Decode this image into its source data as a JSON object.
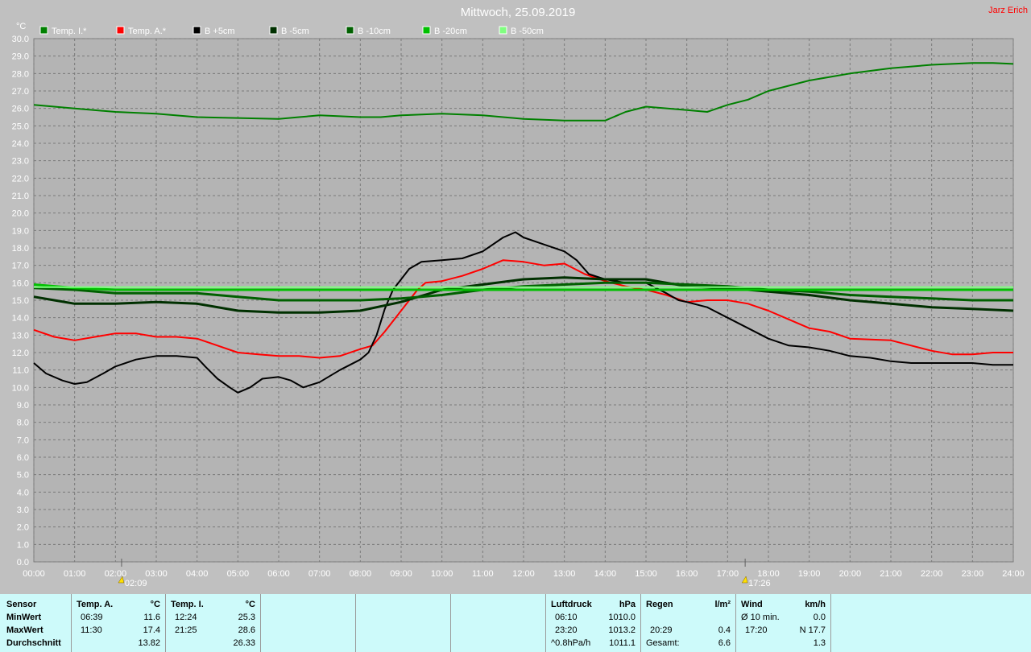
{
  "title": "Mittwoch, 25.09.2019",
  "author": "Jarz Erich",
  "chart_data": {
    "type": "line",
    "ylabel": "°C",
    "ylim": [
      0,
      30
    ],
    "ytick_step": 1,
    "xlim": [
      0,
      24
    ],
    "x_ticks": [
      "00:00",
      "01:00",
      "02:00",
      "03:00",
      "04:00",
      "05:00",
      "06:00",
      "07:00",
      "08:00",
      "09:00",
      "10:00",
      "11:00",
      "12:00",
      "13:00",
      "14:00",
      "15:00",
      "16:00",
      "17:00",
      "18:00",
      "19:00",
      "20:00",
      "21:00",
      "22:00",
      "23:00",
      "24:00"
    ],
    "grid": true,
    "legend_position": "top",
    "sunrise": {
      "hour": 2.15,
      "label": "02:09"
    },
    "sunset": {
      "hour": 17.43,
      "label": "17:26"
    },
    "series": [
      {
        "name": "Temp. I.*",
        "color": "#008000",
        "width": 2,
        "points": [
          [
            0,
            26.2
          ],
          [
            1,
            26.0
          ],
          [
            2,
            25.8
          ],
          [
            3,
            25.7
          ],
          [
            4,
            25.5
          ],
          [
            5,
            25.45
          ],
          [
            6,
            25.4
          ],
          [
            6.5,
            25.5
          ],
          [
            7,
            25.6
          ],
          [
            8,
            25.5
          ],
          [
            8.5,
            25.5
          ],
          [
            9,
            25.6
          ],
          [
            10,
            25.7
          ],
          [
            11,
            25.6
          ],
          [
            12,
            25.4
          ],
          [
            13,
            25.3
          ],
          [
            14,
            25.3
          ],
          [
            14.5,
            25.8
          ],
          [
            15,
            26.1
          ],
          [
            16,
            25.9
          ],
          [
            16.5,
            25.8
          ],
          [
            17,
            26.2
          ],
          [
            17.5,
            26.5
          ],
          [
            18,
            27.0
          ],
          [
            18.5,
            27.3
          ],
          [
            19,
            27.6
          ],
          [
            20,
            28.0
          ],
          [
            21,
            28.3
          ],
          [
            22,
            28.5
          ],
          [
            23,
            28.6
          ],
          [
            23.5,
            28.6
          ],
          [
            24,
            28.55
          ]
        ]
      },
      {
        "name": "Temp. A.*",
        "color": "#ff0000",
        "width": 2,
        "points": [
          [
            0,
            13.3
          ],
          [
            0.5,
            12.9
          ],
          [
            1,
            12.7
          ],
          [
            1.5,
            12.9
          ],
          [
            2,
            13.1
          ],
          [
            2.5,
            13.1
          ],
          [
            3,
            12.9
          ],
          [
            3.5,
            12.9
          ],
          [
            4,
            12.8
          ],
          [
            4.5,
            12.4
          ],
          [
            5,
            12.0
          ],
          [
            5.5,
            11.9
          ],
          [
            6,
            11.8
          ],
          [
            6.5,
            11.8
          ],
          [
            7,
            11.7
          ],
          [
            7.5,
            11.8
          ],
          [
            8,
            12.2
          ],
          [
            8.3,
            12.4
          ],
          [
            8.6,
            13.2
          ],
          [
            9,
            14.4
          ],
          [
            9.2,
            15.0
          ],
          [
            9.4,
            15.6
          ],
          [
            9.6,
            16.0
          ],
          [
            10,
            16.1
          ],
          [
            10.5,
            16.4
          ],
          [
            11,
            16.8
          ],
          [
            11.5,
            17.3
          ],
          [
            12,
            17.2
          ],
          [
            12.5,
            17.0
          ],
          [
            13,
            17.1
          ],
          [
            13.5,
            16.5
          ],
          [
            14,
            16.1
          ],
          [
            14.5,
            15.8
          ],
          [
            15,
            15.6
          ],
          [
            15.5,
            15.3
          ],
          [
            16,
            14.9
          ],
          [
            16.5,
            15.0
          ],
          [
            17,
            15.0
          ],
          [
            17.5,
            14.8
          ],
          [
            18,
            14.4
          ],
          [
            18.5,
            13.9
          ],
          [
            19,
            13.4
          ],
          [
            19.5,
            13.2
          ],
          [
            20,
            12.8
          ],
          [
            21,
            12.7
          ],
          [
            21.5,
            12.4
          ],
          [
            22,
            12.1
          ],
          [
            22.5,
            11.9
          ],
          [
            23,
            11.9
          ],
          [
            23.5,
            12.0
          ],
          [
            24,
            12.0
          ]
        ]
      },
      {
        "name": "B +5cm",
        "color": "#000000",
        "width": 2,
        "points": [
          [
            0,
            11.4
          ],
          [
            0.3,
            10.8
          ],
          [
            0.7,
            10.4
          ],
          [
            1,
            10.2
          ],
          [
            1.3,
            10.3
          ],
          [
            1.7,
            10.8
          ],
          [
            2,
            11.2
          ],
          [
            2.5,
            11.6
          ],
          [
            3,
            11.8
          ],
          [
            3.5,
            11.8
          ],
          [
            4,
            11.7
          ],
          [
            4.2,
            11.2
          ],
          [
            4.5,
            10.5
          ],
          [
            4.8,
            10.0
          ],
          [
            5,
            9.7
          ],
          [
            5.3,
            10.0
          ],
          [
            5.6,
            10.5
          ],
          [
            6,
            10.6
          ],
          [
            6.3,
            10.4
          ],
          [
            6.6,
            10.0
          ],
          [
            7,
            10.3
          ],
          [
            7.5,
            11.0
          ],
          [
            8,
            11.6
          ],
          [
            8.2,
            12.0
          ],
          [
            8.4,
            13.0
          ],
          [
            8.6,
            14.5
          ],
          [
            8.8,
            15.6
          ],
          [
            9,
            16.2
          ],
          [
            9.2,
            16.8
          ],
          [
            9.5,
            17.2
          ],
          [
            10,
            17.3
          ],
          [
            10.5,
            17.4
          ],
          [
            11,
            17.8
          ],
          [
            11.5,
            18.6
          ],
          [
            11.8,
            18.9
          ],
          [
            12,
            18.6
          ],
          [
            12.5,
            18.2
          ],
          [
            13,
            17.8
          ],
          [
            13.3,
            17.3
          ],
          [
            13.6,
            16.5
          ],
          [
            14,
            16.2
          ],
          [
            14.5,
            16.0
          ],
          [
            15,
            16.0
          ],
          [
            15.5,
            15.4
          ],
          [
            15.8,
            15.0
          ],
          [
            16,
            14.9
          ],
          [
            16.5,
            14.6
          ],
          [
            17,
            14.0
          ],
          [
            17.5,
            13.4
          ],
          [
            18,
            12.8
          ],
          [
            18.5,
            12.4
          ],
          [
            19,
            12.3
          ],
          [
            19.5,
            12.1
          ],
          [
            20,
            11.8
          ],
          [
            20.5,
            11.7
          ],
          [
            21,
            11.5
          ],
          [
            21.5,
            11.4
          ],
          [
            22,
            11.4
          ],
          [
            22.5,
            11.4
          ],
          [
            23,
            11.4
          ],
          [
            23.5,
            11.3
          ],
          [
            24,
            11.3
          ]
        ]
      },
      {
        "name": "B -5cm",
        "color": "#003000",
        "width": 3,
        "points": [
          [
            0,
            15.2
          ],
          [
            0.5,
            15.0
          ],
          [
            1,
            14.8
          ],
          [
            2,
            14.8
          ],
          [
            3,
            14.9
          ],
          [
            4,
            14.8
          ],
          [
            5,
            14.4
          ],
          [
            6,
            14.3
          ],
          [
            7,
            14.3
          ],
          [
            8,
            14.4
          ],
          [
            9,
            14.9
          ],
          [
            10,
            15.6
          ],
          [
            11,
            15.9
          ],
          [
            12,
            16.2
          ],
          [
            13,
            16.3
          ],
          [
            14,
            16.2
          ],
          [
            15,
            16.2
          ],
          [
            16,
            15.8
          ],
          [
            17,
            15.7
          ],
          [
            18,
            15.5
          ],
          [
            19,
            15.3
          ],
          [
            20,
            15.0
          ],
          [
            21,
            14.8
          ],
          [
            22,
            14.6
          ],
          [
            23,
            14.5
          ],
          [
            24,
            14.4
          ]
        ]
      },
      {
        "name": "B -10cm",
        "color": "#006000",
        "width": 3,
        "points": [
          [
            0,
            15.7
          ],
          [
            1,
            15.6
          ],
          [
            2,
            15.4
          ],
          [
            3,
            15.4
          ],
          [
            4,
            15.4
          ],
          [
            5,
            15.2
          ],
          [
            6,
            15.0
          ],
          [
            7,
            15.0
          ],
          [
            8,
            15.0
          ],
          [
            9,
            15.1
          ],
          [
            10,
            15.3
          ],
          [
            11,
            15.6
          ],
          [
            12,
            15.8
          ],
          [
            13,
            15.9
          ],
          [
            14,
            16.0
          ],
          [
            15,
            16.0
          ],
          [
            16,
            15.9
          ],
          [
            17,
            15.8
          ],
          [
            18,
            15.6
          ],
          [
            19,
            15.5
          ],
          [
            20,
            15.3
          ],
          [
            21,
            15.2
          ],
          [
            22,
            15.1
          ],
          [
            23,
            15.0
          ],
          [
            24,
            15.0
          ]
        ]
      },
      {
        "name": "B -20cm",
        "color": "#00c000",
        "width": 3,
        "points": [
          [
            0,
            15.9
          ],
          [
            1,
            15.7
          ],
          [
            2,
            15.6
          ],
          [
            3,
            15.6
          ],
          [
            4,
            15.6
          ],
          [
            5,
            15.6
          ],
          [
            6,
            15.6
          ],
          [
            7,
            15.6
          ],
          [
            8,
            15.6
          ],
          [
            9,
            15.6
          ],
          [
            10,
            15.6
          ],
          [
            11,
            15.6
          ],
          [
            12,
            15.6
          ],
          [
            13,
            15.6
          ],
          [
            14,
            15.6
          ],
          [
            15,
            15.6
          ],
          [
            16,
            15.6
          ],
          [
            17,
            15.6
          ],
          [
            18,
            15.6
          ],
          [
            19,
            15.6
          ],
          [
            20,
            15.6
          ],
          [
            21,
            15.6
          ],
          [
            22,
            15.6
          ],
          [
            23,
            15.6
          ],
          [
            24,
            15.6
          ]
        ]
      },
      {
        "name": "B -50cm",
        "color": "#80ff80",
        "width": 2,
        "points": [
          [
            0,
            15.75
          ],
          [
            24,
            15.75
          ]
        ]
      }
    ]
  },
  "table": {
    "sensor": {
      "header": "Sensor",
      "rows": [
        "MinWert",
        "MaxWert",
        "Durchschnitt"
      ]
    },
    "temp_a": {
      "header": "Temp. A.",
      "unit": "°C",
      "min_time": "06:39",
      "min_val": "11.6",
      "max_time": "11:30",
      "max_val": "17.4",
      "avg": "13.82"
    },
    "temp_i": {
      "header": "Temp. I.",
      "unit": "°C",
      "min_time": "12:24",
      "min_val": "25.3",
      "max_time": "21:25",
      "max_val": "28.6",
      "avg": "26.33"
    },
    "luftdruck": {
      "header": "Luftdruck",
      "unit": "hPa",
      "min_time": "06:10",
      "min_val": "1010.0",
      "max_time": "23:20",
      "max_val": "1013.2",
      "avg_label": "^0.8hPa/h",
      "avg": "1011.1"
    },
    "regen": {
      "header": "Regen",
      "unit": "l/m²",
      "max_time": "20:29",
      "max_val": "0.4",
      "avg_label": "Gesamt:",
      "avg": "6.6"
    },
    "wind": {
      "header": "Wind",
      "unit": "km/h",
      "min_time": "Ø 10 min.",
      "min_val": "0.0",
      "max_time": "17:20",
      "max_val": "N 17.7",
      "avg": "1.3"
    }
  }
}
